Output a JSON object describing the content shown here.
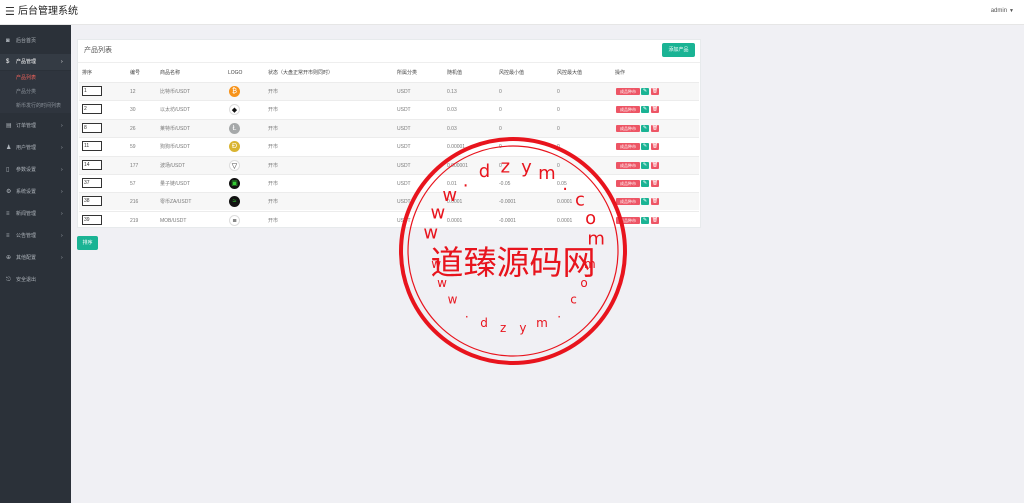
{
  "header": {
    "title": "后台管理系统",
    "user": "admin"
  },
  "sidebar": {
    "items": [
      {
        "label": "后台首页",
        "icon": "dashboard-icon",
        "glyph": "◙"
      },
      {
        "label": "产品管理",
        "icon": "product-icon",
        "glyph": "$",
        "active": true
      },
      {
        "label": "订单管理",
        "icon": "order-icon",
        "glyph": "▤"
      },
      {
        "label": "用户管理",
        "icon": "user-icon",
        "glyph": "♟"
      },
      {
        "label": "参数设置",
        "icon": "settings-file-icon",
        "glyph": "▯"
      },
      {
        "label": "系统设置",
        "icon": "gear-icon",
        "glyph": "⚙"
      },
      {
        "label": "新闻管理",
        "icon": "news-icon",
        "glyph": "≡"
      },
      {
        "label": "公告管理",
        "icon": "notice-icon",
        "glyph": "≡"
      },
      {
        "label": "其他配置",
        "icon": "globe-icon",
        "glyph": "⊕"
      },
      {
        "label": "安全退出",
        "icon": "logout-icon",
        "glyph": "⎋"
      }
    ],
    "subitems": [
      {
        "label": "产品列表",
        "current": true
      },
      {
        "label": "产品分类"
      },
      {
        "label": "新币发行的时间列表"
      }
    ]
  },
  "panel": {
    "title": "产品列表",
    "add_label": "添加产品",
    "sort_label": "排序",
    "columns": [
      "排序",
      "编号",
      "商品名称",
      "LOGO",
      "状态（大盘正常开市则同时）",
      "所属分类",
      "随机值",
      "风控最小值",
      "风控最大值",
      "操作"
    ]
  },
  "rows": [
    {
      "sort": "1",
      "id": "12",
      "name": "比特币/USDT",
      "logo": "bitcoin-logo",
      "color": "#f7931a",
      "glyph": "₿",
      "status": "开市",
      "category": "USDT",
      "random": "0.13",
      "min": "0",
      "max": "0"
    },
    {
      "sort": "2",
      "id": "30",
      "name": "以太坊/USDT",
      "logo": "ethereum-logo",
      "color": "#ffffff",
      "glyph": "◆",
      "status": "开市",
      "category": "USDT",
      "random": "0.03",
      "min": "0",
      "max": "0"
    },
    {
      "sort": "8",
      "id": "26",
      "name": "莱特币/USDT",
      "logo": "litecoin-logo",
      "color": "#a6a9aa",
      "glyph": "Ł",
      "status": "开市",
      "category": "USDT",
      "random": "0.03",
      "min": "0",
      "max": "0"
    },
    {
      "sort": "11",
      "id": "59",
      "name": "狗狗币/USDT",
      "logo": "dogecoin-logo",
      "color": "#d9b431",
      "glyph": "Ð",
      "status": "开市",
      "category": "USDT",
      "random": "0.00001",
      "min": "0",
      "max": "0"
    },
    {
      "sort": "14",
      "id": "177",
      "name": "波场/USDT",
      "logo": "tron-logo",
      "color": "#ffffff",
      "glyph": "▽",
      "status": "开市",
      "category": "USDT",
      "random": "0.000001",
      "min": "0",
      "max": "0"
    },
    {
      "sort": "37",
      "id": "57",
      "name": "量子链/USDT",
      "logo": "qtum-logo",
      "color": "#111111",
      "glyph": "▣",
      "status": "开市",
      "category": "USDT",
      "random": "0.01",
      "min": "-0.05",
      "max": "0.05"
    },
    {
      "sort": "38",
      "id": "216",
      "name": "零币ZA/USDT",
      "logo": "zen-logo",
      "color": "#111111",
      "glyph": "≈",
      "status": "开市",
      "category": "USDT",
      "random": "0.0001",
      "min": "-0.0001",
      "max": "0.0001"
    },
    {
      "sort": "39",
      "id": "219",
      "name": "MOB/USDT",
      "logo": "mob-logo",
      "color": "#ffffff",
      "glyph": "≡",
      "status": "开市",
      "category": "USDT",
      "random": "0.0001",
      "min": "-0.0001",
      "max": "0.0001"
    }
  ],
  "row_actions": {
    "follow_label": "成品种市",
    "edit_glyph": "✎",
    "delete_glyph": "🗑"
  },
  "watermark": {
    "text": "道臻源码网",
    "url": "www.dzym.com",
    "color": "#e8141d"
  }
}
